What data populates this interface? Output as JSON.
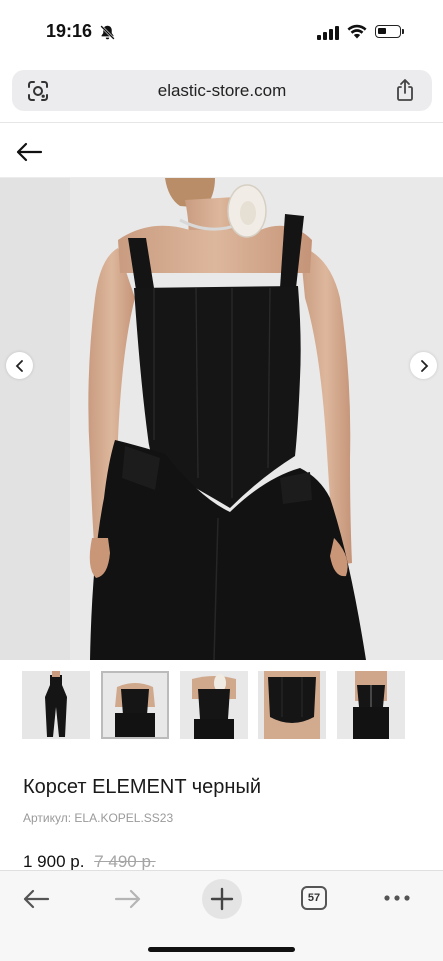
{
  "status_bar": {
    "time": "19:16"
  },
  "browser": {
    "url": "elastic-store.com",
    "open_tabs_count": "57"
  },
  "product": {
    "title": "Корсет ELEMENT черный",
    "sku_label": "Артикул:",
    "sku_value": "ELA.KOPEL.SS23",
    "price_current": "1 900 р.",
    "price_old": "7 490 р."
  },
  "gallery": {
    "thumbnail_count": 5,
    "active_thumbnail": 2
  },
  "colors": {
    "garment": "#141414",
    "background": "#e8e8e8",
    "urlbar": "#ececee"
  }
}
